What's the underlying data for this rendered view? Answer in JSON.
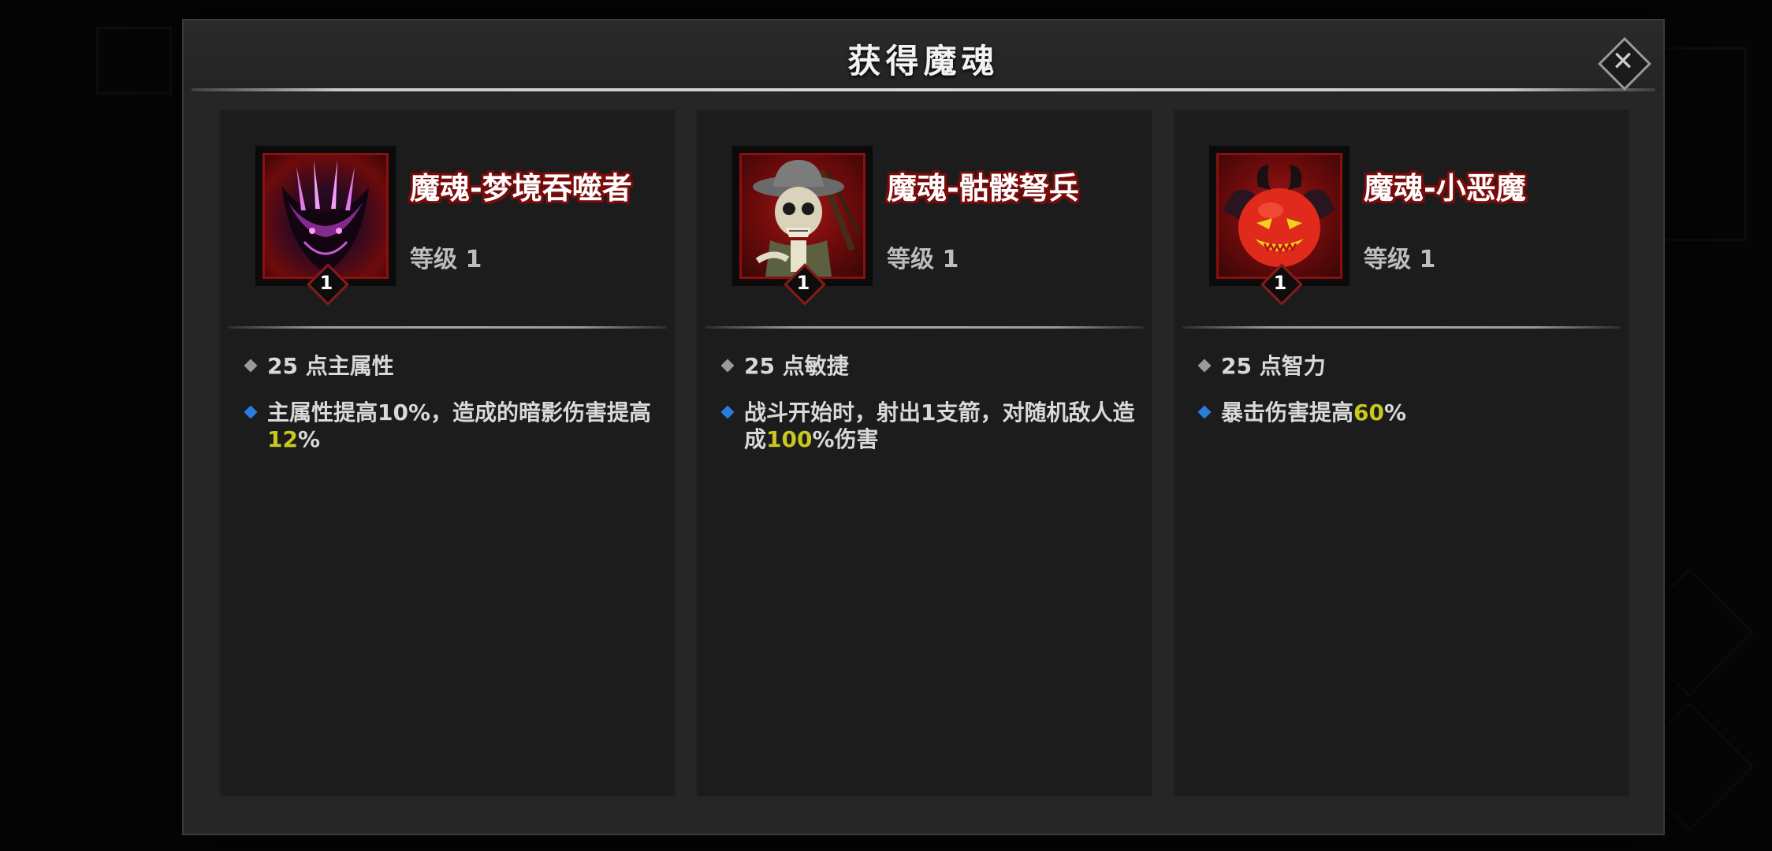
{
  "dialog": {
    "title": "获得魔魂",
    "close_label": "✕"
  },
  "colors": {
    "dialog_bg": "#262626",
    "card_bg": "#1c1c1c",
    "name_outline": "#7a0b0b",
    "highlight": "#c8c81e",
    "bullet_blue": "#2a7ddc",
    "bullet_grey": "#9a9a9a"
  },
  "cards": [
    {
      "name": "魔魂-梦境吞噬者",
      "level_label": "等级 1",
      "badge": "1",
      "icon": "shadow-dragon-icon",
      "stat": "25 点主属性",
      "effect_prefix": "主属性提高10%，造成的暗影伤害提高",
      "effect_value": "12",
      "effect_suffix": "%"
    },
    {
      "name": "魔魂-骷髅弩兵",
      "level_label": "等级 1",
      "badge": "1",
      "icon": "skeleton-crossbowman-icon",
      "stat": "25 点敏捷",
      "effect_prefix": "战斗开始时，射出1支箭，对随机敌人造成",
      "effect_value": "100",
      "effect_suffix": "%伤害"
    },
    {
      "name": "魔魂-小恶魔",
      "level_label": "等级 1",
      "badge": "1",
      "icon": "imp-icon",
      "stat": "25 点智力",
      "effect_prefix": "暴击伤害提高",
      "effect_value": "60",
      "effect_suffix": "%"
    }
  ]
}
